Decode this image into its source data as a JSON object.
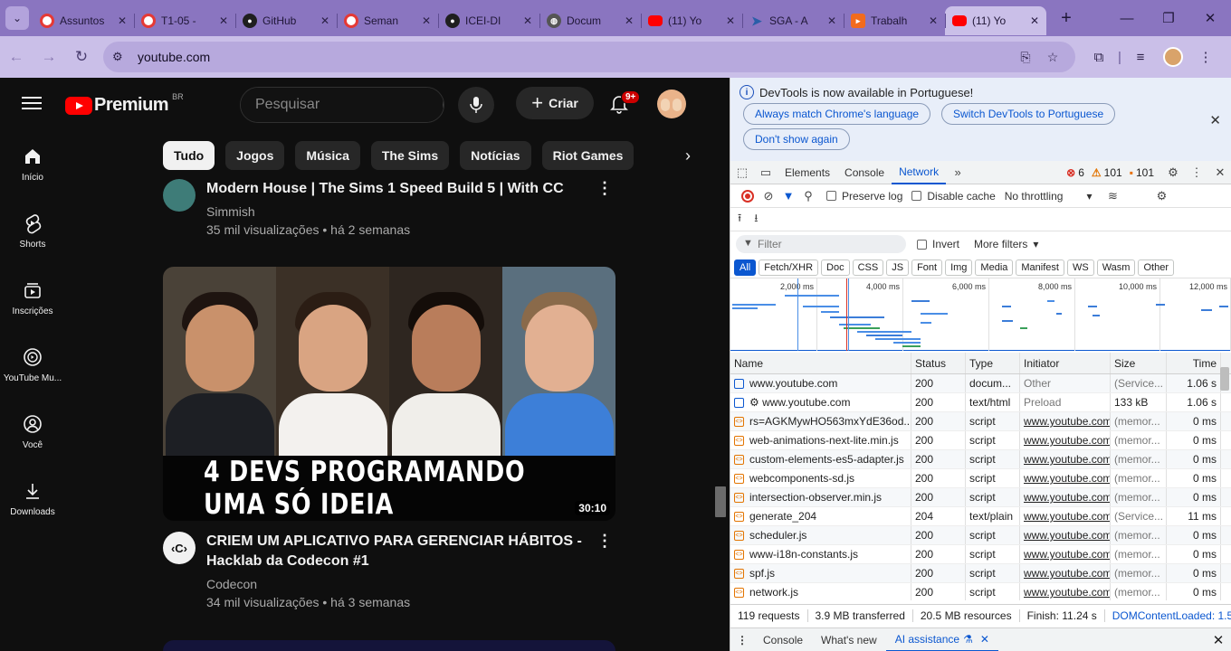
{
  "browser": {
    "tabs": [
      {
        "title": "Assuntos",
        "favicon": "ring-icon"
      },
      {
        "title": "T1-05 -",
        "favicon": "ring-icon"
      },
      {
        "title": "GitHub",
        "favicon": "github-icon"
      },
      {
        "title": "Seman",
        "favicon": "ring-icon"
      },
      {
        "title": "ICEI-DI",
        "favicon": "github-icon"
      },
      {
        "title": "Docum",
        "favicon": "globe-icon"
      },
      {
        "title": "(11) Yo",
        "favicon": "youtube-icon"
      },
      {
        "title": "SGA - A",
        "favicon": "sga-icon"
      },
      {
        "title": "Trabalh",
        "favicon": "trabalho-icon"
      },
      {
        "title": "(11) Yo",
        "favicon": "youtube-icon",
        "active": true
      }
    ],
    "url": "youtube.com"
  },
  "youtube": {
    "logo_text": "Premium",
    "country": "BR",
    "search_placeholder": "Pesquisar",
    "create_label": "Criar",
    "notif_count": "9+",
    "guide": [
      {
        "label": "Início",
        "icon": "home-icon"
      },
      {
        "label": "Shorts",
        "icon": "shorts-icon"
      },
      {
        "label": "Inscrições",
        "icon": "subscriptions-icon"
      },
      {
        "label": "YouTube Mu...",
        "icon": "youtube-music-icon"
      },
      {
        "label": "Você",
        "icon": "you-icon"
      },
      {
        "label": "Downloads",
        "icon": "download-icon"
      }
    ],
    "chips": [
      "Tudo",
      "Jogos",
      "Música",
      "The Sims",
      "Notícias",
      "Riot Games"
    ],
    "videos": [
      {
        "title": "Modern House | The Sims 1 Speed Build 5 | With CC",
        "channel": "Simmish",
        "meta": "35 mil visualizações • há 2 semanas"
      },
      {
        "title": "CRIEM UM APLICATIVO PARA GERENCIAR HÁBITOS - Hacklab da Codecon #1",
        "channel": "Codecon",
        "meta": "34 mil visualizações • há 3 semanas",
        "thumb_text": "4 DEVS PROGRAMANDO UMA SÓ IDEIA",
        "duration": "30:10"
      }
    ]
  },
  "devtools": {
    "info_message": "DevTools is now available in Portuguese!",
    "info_buttons": [
      "Always match Chrome's language",
      "Switch DevTools to Portuguese",
      "Don't show again"
    ],
    "tabs": [
      "Elements",
      "Console",
      "Network"
    ],
    "active_tab": "Network",
    "errors": "6",
    "warnings": "101",
    "issues": "101",
    "preserve_log": "Preserve log",
    "disable_cache": "Disable cache",
    "throttling": "No throttling",
    "filter_placeholder": "Filter",
    "invert": "Invert",
    "more_filters": "More filters",
    "type_filters": [
      "All",
      "Fetch/XHR",
      "Doc",
      "CSS",
      "JS",
      "Font",
      "Img",
      "Media",
      "Manifest",
      "WS",
      "Wasm",
      "Other"
    ],
    "overview_ticks": [
      "2,000 ms",
      "4,000 ms",
      "6,000 ms",
      "8,000 ms",
      "10,000 ms",
      "12,000 ms"
    ],
    "columns": [
      "Name",
      "Status",
      "Type",
      "Initiator",
      "Size",
      "Time"
    ],
    "requests": [
      {
        "name": "www.youtube.com",
        "status": "200",
        "type": "docum...",
        "initiator": "Other",
        "size": "(Service...",
        "time": "1.06 s",
        "icon": "doc"
      },
      {
        "name": "⚙ www.youtube.com",
        "status": "200",
        "type": "text/html",
        "initiator": "Preload",
        "size": "133 kB",
        "time": "1.06 s",
        "icon": "doc"
      },
      {
        "name": "rs=AGKMywHO563mxYdE36od...",
        "status": "200",
        "type": "script",
        "initiator": "www.youtube.com",
        "size": "(memor...",
        "time": "0 ms",
        "icon": "js"
      },
      {
        "name": "web-animations-next-lite.min.js",
        "status": "200",
        "type": "script",
        "initiator": "www.youtube.com",
        "size": "(memor...",
        "time": "0 ms",
        "icon": "js"
      },
      {
        "name": "custom-elements-es5-adapter.js",
        "status": "200",
        "type": "script",
        "initiator": "www.youtube.com",
        "size": "(memor...",
        "time": "0 ms",
        "icon": "js"
      },
      {
        "name": "webcomponents-sd.js",
        "status": "200",
        "type": "script",
        "initiator": "www.youtube.com",
        "size": "(memor...",
        "time": "0 ms",
        "icon": "js"
      },
      {
        "name": "intersection-observer.min.js",
        "status": "200",
        "type": "script",
        "initiator": "www.youtube.com",
        "size": "(memor...",
        "time": "0 ms",
        "icon": "js"
      },
      {
        "name": "generate_204",
        "status": "204",
        "type": "text/plain",
        "initiator": "www.youtube.com",
        "size": "(Service...",
        "time": "11 ms",
        "icon": "js"
      },
      {
        "name": "scheduler.js",
        "status": "200",
        "type": "script",
        "initiator": "www.youtube.com",
        "size": "(memor...",
        "time": "0 ms",
        "icon": "js"
      },
      {
        "name": "www-i18n-constants.js",
        "status": "200",
        "type": "script",
        "initiator": "www.youtube.com",
        "size": "(memor...",
        "time": "0 ms",
        "icon": "js"
      },
      {
        "name": "spf.js",
        "status": "200",
        "type": "script",
        "initiator": "www.youtube.com",
        "size": "(memor...",
        "time": "0 ms",
        "icon": "js"
      },
      {
        "name": "network.js",
        "status": "200",
        "type": "script",
        "initiator": "www.youtube.com",
        "size": "(memor...",
        "time": "0 ms",
        "icon": "js"
      }
    ],
    "summary": {
      "requests": "119 requests",
      "transferred": "3.9 MB transferred",
      "resources": "20.5 MB resources",
      "finish": "Finish: 11.24 s",
      "dcl": "DOMContentLoaded: 1.5"
    },
    "drawer_tabs": [
      "Console",
      "What's new",
      "AI assistance"
    ],
    "drawer_active": "AI assistance"
  }
}
